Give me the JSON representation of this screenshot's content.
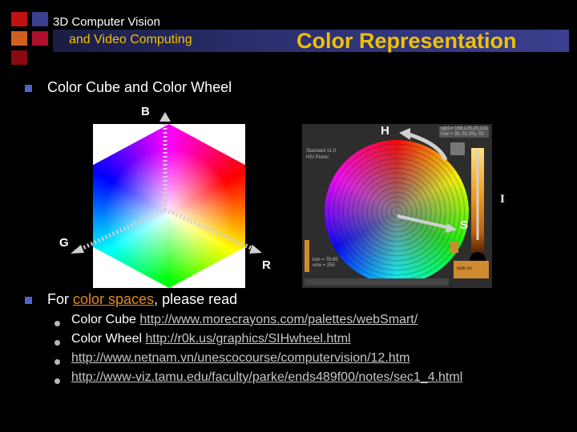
{
  "header": {
    "course_line1": "3D Computer Vision",
    "course_line2": "and Video Computing",
    "slide_title": "Color Representation"
  },
  "colors": {
    "title_accent": "#f0c000",
    "bullet": "#4a66c8",
    "link": "#c8c8c8",
    "link_highlight": "#e08a20"
  },
  "bullet1": {
    "text": "Color Cube and Color Wheel"
  },
  "cube": {
    "label_b": "B",
    "label_g": "G",
    "label_r": "R"
  },
  "wheel": {
    "label_h": "H",
    "label_i": "I",
    "label_s": "S",
    "panel_text_1": "Standard v1.0",
    "panel_text_2": "HSI Picker",
    "panel_text_3": "rgb1= 168,125,20,131",
    "panel_text_4": "hue = 35, 81.8%, 55",
    "panel_text_5": "lum = 78.65",
    "panel_text_6": "vmx = 255",
    "panel_text_7": "web ex"
  },
  "bullet2": {
    "prefix": "For ",
    "link_text": "color spaces",
    "suffix": ", please read",
    "items": [
      {
        "label": "Color Cube ",
        "url": "http://www.morecrayons.com/palettes/webSmart/"
      },
      {
        "label": "Color Wheel ",
        "url": "http://r0k.us/graphics/SIHwheel.html"
      },
      {
        "label": "",
        "url": "http://www.netnam.vn/unescocourse/computervision/12.htm"
      },
      {
        "label": "",
        "url": "http://www-viz.tamu.edu/faculty/parke/ends489f00/notes/sec1_4.html"
      }
    ]
  }
}
